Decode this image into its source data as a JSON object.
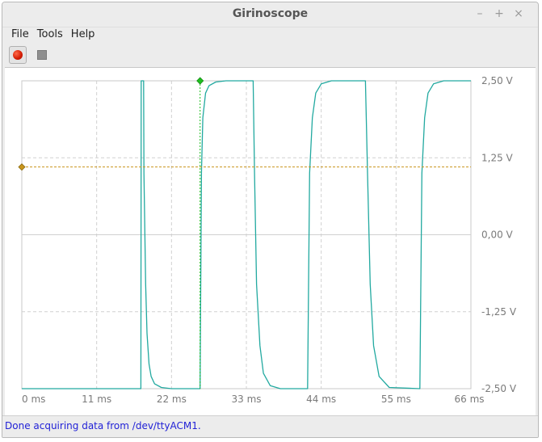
{
  "window": {
    "title": "Girinoscope"
  },
  "window_controls": {
    "minimize": "–",
    "maximize": "+",
    "close": "×"
  },
  "menu": {
    "items": [
      "File",
      "Tools",
      "Help"
    ]
  },
  "toolbar": {
    "record_icon": "record-icon",
    "stop_icon": "stop-icon"
  },
  "status": {
    "text": "Done acquiring data from /dev/ttyACM1."
  },
  "colors": {
    "signal": "#22a9a0",
    "trigger_level": "#c9951c",
    "trigger_marker": "#1fbf1f",
    "status_text": "#1f1fd6"
  },
  "chart_data": {
    "type": "line",
    "x_tick_labels": [
      "0 ms",
      "11 ms",
      "22 ms",
      "33 ms",
      "44 ms",
      "55 ms",
      "66 ms"
    ],
    "y_tick_labels": [
      "2,50 V",
      "1,25 V",
      "0,00 V",
      "-1,25 V",
      "-2,50 V"
    ],
    "x_unit": "ms",
    "y_unit": "V",
    "xlim": [
      0,
      66
    ],
    "ylim": [
      -2.5,
      2.5
    ],
    "grid": true,
    "trigger_level_v": 1.1,
    "trigger_time_ms": 26.2,
    "series": [
      {
        "x": [
          0,
          17.5,
          17.55,
          17.9,
          17.95,
          18.2,
          18.4,
          18.7,
          19.0,
          19.5,
          20.5,
          22.0,
          23.5,
          25.5,
          26.2,
          26.4,
          26.6,
          27.0,
          27.5,
          28.5,
          30.0,
          34.0,
          34.2,
          34.5,
          35.0,
          35.5,
          36.5,
          38.0,
          42.0,
          42.3,
          42.7,
          43.2,
          44.0,
          45.5,
          47.5,
          50.5,
          50.8,
          51.2,
          51.7,
          52.5,
          54.0,
          58.5,
          58.8,
          59.2,
          59.7,
          60.5,
          62.0,
          66.0
        ],
        "y": [
          -2.5,
          -2.5,
          2.5,
          2.5,
          1.0,
          -0.8,
          -1.6,
          -2.1,
          -2.3,
          -2.42,
          -2.48,
          -2.5,
          -2.5,
          -2.5,
          -2.5,
          1.0,
          1.9,
          2.3,
          2.42,
          2.48,
          2.5,
          2.5,
          1.0,
          -0.8,
          -1.8,
          -2.25,
          -2.45,
          -2.5,
          -2.5,
          1.0,
          1.9,
          2.3,
          2.45,
          2.5,
          2.5,
          2.5,
          1.0,
          -0.8,
          -1.8,
          -2.3,
          -2.48,
          -2.5,
          1.0,
          1.9,
          2.3,
          2.45,
          2.5,
          2.5
        ]
      }
    ]
  }
}
